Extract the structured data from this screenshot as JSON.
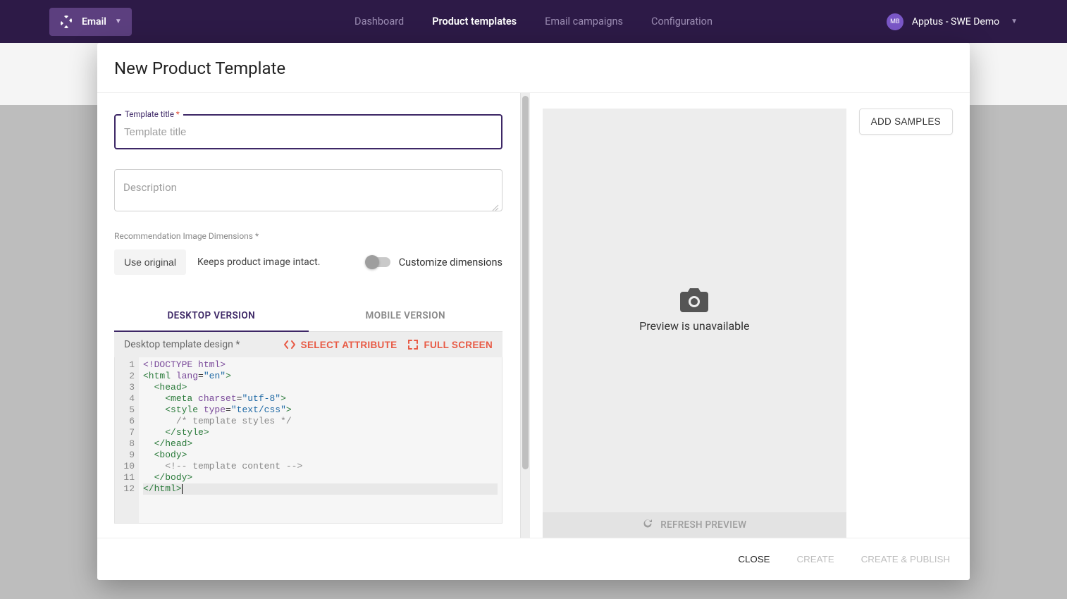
{
  "nav": {
    "app_label": "Email",
    "items": [
      "Dashboard",
      "Product templates",
      "Email campaigns",
      "Configuration"
    ],
    "active_index": 1,
    "account": "Apptus - SWE Demo",
    "avatar_initials": "MB"
  },
  "modal": {
    "title": "New Product Template",
    "template_title": {
      "legend": "Template title",
      "required_mark": "*",
      "placeholder": "Template title",
      "value": ""
    },
    "description": {
      "placeholder": "Description",
      "value": ""
    },
    "dimensions": {
      "label": "Recommendation Image Dimensions *",
      "use_original": "Use original",
      "keeps_text": "Keeps product image intact.",
      "customize_label": "Customize dimensions"
    },
    "tabs": {
      "desktop": "DESKTOP VERSION",
      "mobile": "MOBILE VERSION"
    },
    "editor_head": {
      "label": "Desktop template design *",
      "select_attribute": "SELECT ATTRIBUTE",
      "full_screen": "FULL SCREEN"
    },
    "code_lines": [
      {
        "n": 1,
        "segs": [
          {
            "t": "<!DOCTYPE html>",
            "c": "t-doct"
          }
        ]
      },
      {
        "n": 2,
        "segs": [
          {
            "t": "<html ",
            "c": "t-tag"
          },
          {
            "t": "lang",
            "c": "t-attr"
          },
          {
            "t": "=",
            "c": ""
          },
          {
            "t": "\"en\"",
            "c": "t-str"
          },
          {
            "t": ">",
            "c": "t-tag"
          }
        ]
      },
      {
        "n": 3,
        "segs": [
          {
            "t": "  ",
            "c": ""
          },
          {
            "t": "<head>",
            "c": "t-tag"
          }
        ]
      },
      {
        "n": 4,
        "segs": [
          {
            "t": "    ",
            "c": ""
          },
          {
            "t": "<meta ",
            "c": "t-tag"
          },
          {
            "t": "charset",
            "c": "t-attr"
          },
          {
            "t": "=",
            "c": ""
          },
          {
            "t": "\"utf-8\"",
            "c": "t-str"
          },
          {
            "t": ">",
            "c": "t-tag"
          }
        ]
      },
      {
        "n": 5,
        "segs": [
          {
            "t": "    ",
            "c": ""
          },
          {
            "t": "<style ",
            "c": "t-tag"
          },
          {
            "t": "type",
            "c": "t-attr"
          },
          {
            "t": "=",
            "c": ""
          },
          {
            "t": "\"text/css\"",
            "c": "t-str"
          },
          {
            "t": ">",
            "c": "t-tag"
          }
        ]
      },
      {
        "n": 6,
        "segs": [
          {
            "t": "      ",
            "c": ""
          },
          {
            "t": "/* template styles */",
            "c": "t-cm"
          }
        ]
      },
      {
        "n": 7,
        "segs": [
          {
            "t": "    ",
            "c": ""
          },
          {
            "t": "</style>",
            "c": "t-tag"
          }
        ]
      },
      {
        "n": 8,
        "segs": [
          {
            "t": "  ",
            "c": ""
          },
          {
            "t": "</head>",
            "c": "t-tag"
          }
        ]
      },
      {
        "n": 9,
        "segs": [
          {
            "t": "  ",
            "c": ""
          },
          {
            "t": "<body>",
            "c": "t-tag"
          }
        ]
      },
      {
        "n": 10,
        "segs": [
          {
            "t": "    ",
            "c": ""
          },
          {
            "t": "<!-- template content -->",
            "c": "t-cm"
          }
        ]
      },
      {
        "n": 11,
        "segs": [
          {
            "t": "  ",
            "c": ""
          },
          {
            "t": "</body>",
            "c": "t-tag"
          }
        ]
      },
      {
        "n": 12,
        "hl": true,
        "caret": true,
        "segs": [
          {
            "t": "</html>",
            "c": "t-tag"
          }
        ]
      }
    ],
    "preview": {
      "message": "Preview is unavailable",
      "refresh": "REFRESH PREVIEW",
      "add_samples": "ADD SAMPLES"
    },
    "footer": {
      "close": "CLOSE",
      "create": "CREATE",
      "create_publish": "CREATE & PUBLISH"
    }
  }
}
